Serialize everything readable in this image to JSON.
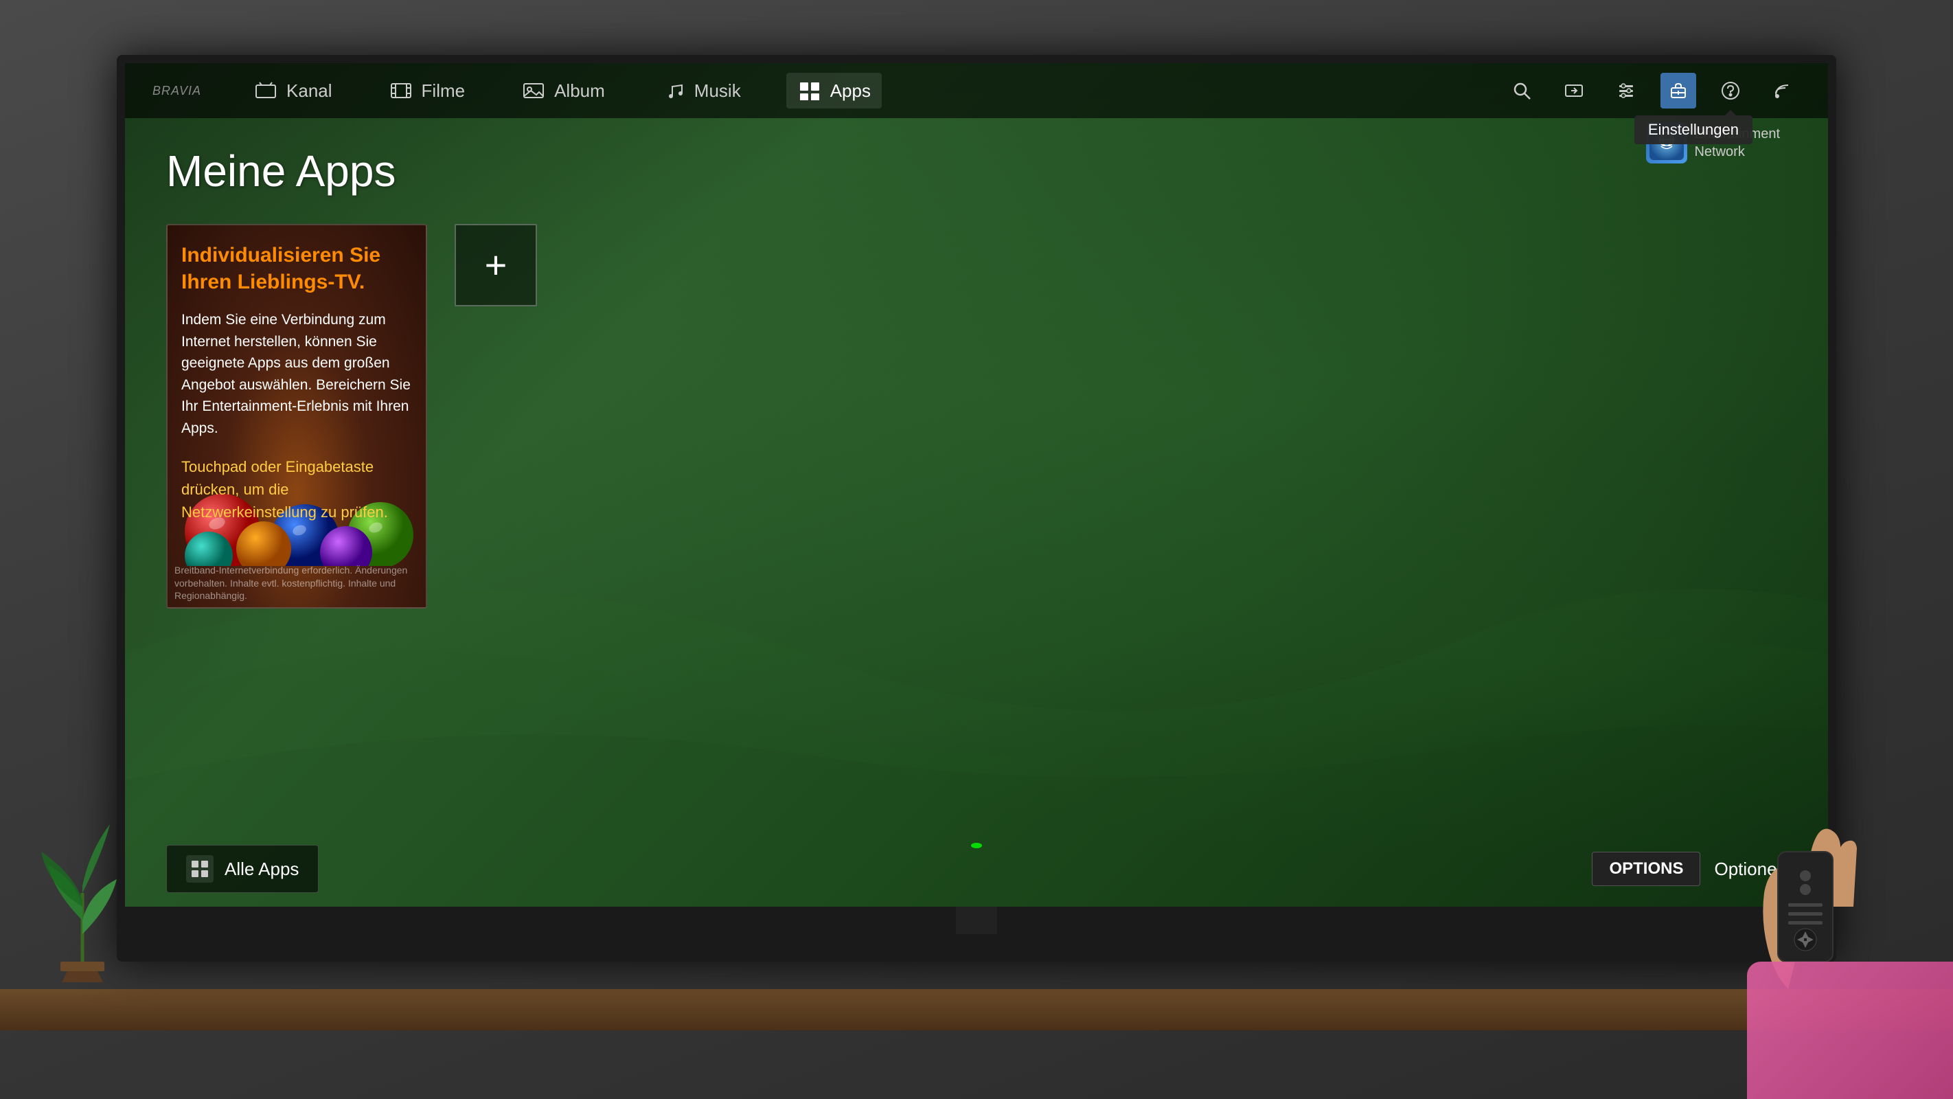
{
  "brand": "BRAVIA",
  "nav": {
    "items": [
      {
        "id": "kanal",
        "label": "Kanal",
        "icon": "tv"
      },
      {
        "id": "filme",
        "label": "Filme",
        "icon": "film"
      },
      {
        "id": "album",
        "label": "Album",
        "icon": "photo"
      },
      {
        "id": "musik",
        "label": "Musik",
        "icon": "music"
      },
      {
        "id": "apps",
        "label": "Apps",
        "icon": "apps",
        "active": true
      }
    ],
    "icons": [
      "search",
      "input",
      "settings-gear",
      "suitcase",
      "help",
      "rss"
    ]
  },
  "settings_tooltip": "Einstellungen",
  "entertainment_network": {
    "line1": "Entertainment",
    "line2": "Network"
  },
  "page_title": "Meine Apps",
  "promo": {
    "title": "Individualisieren Sie Ihren Lieblings-TV.",
    "body": "Indem Sie eine Verbindung zum Internet herstellen, können Sie geeignete Apps aus dem großen Angebot auswählen. Bereichern Sie Ihr Entertainment-Erlebnis mit Ihren Apps.",
    "instruction": "Touchpad oder Eingabetaste drücken, um die Netzwerkeinstellung zu prüfen.",
    "disclaimer": "Breitband-Internetverbindung erforderlich. Änderungen vorbehalten. Inhalte evtl. kostenpflichtig. Inhalte und Regionabhängig."
  },
  "add_app": {
    "symbol": "+"
  },
  "all_apps": {
    "label": "Alle Apps"
  },
  "options": {
    "key": "OPTIONS",
    "label": "Optionen"
  }
}
